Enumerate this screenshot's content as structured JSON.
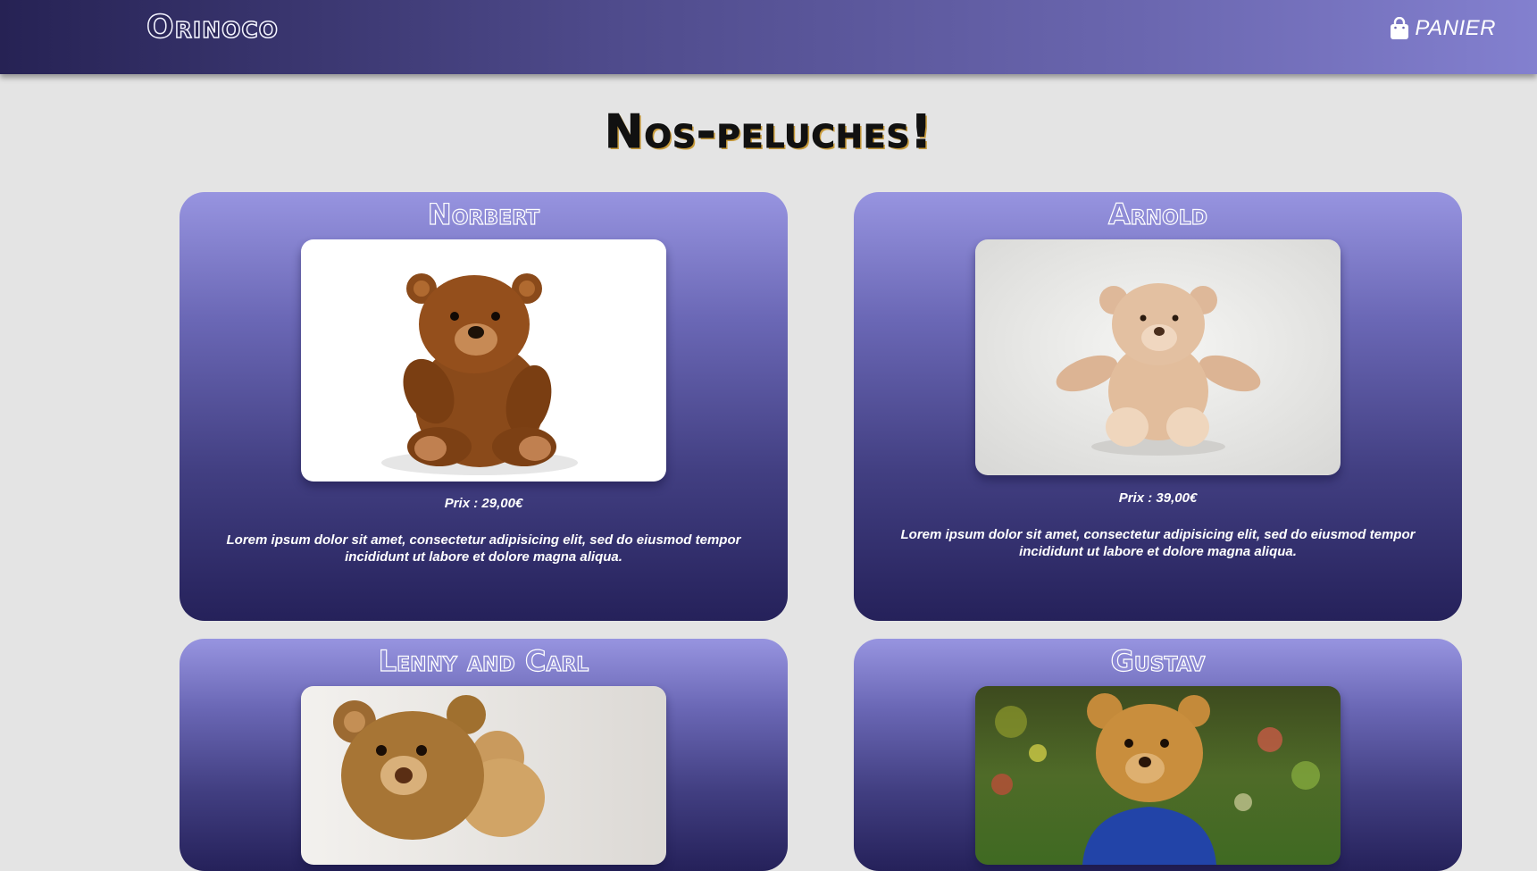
{
  "header": {
    "logo": "Orinoco",
    "cart_label": "PANIER",
    "cart_icon": "shopping-bag-icon"
  },
  "main": {
    "title": "Nos-peluches!"
  },
  "products": [
    {
      "name": "Norbert",
      "price": "Prix : 29,00€",
      "description": "Lorem ipsum dolor sit amet, consectetur adipisicing elit, sed do eiusmod tempor incididunt ut labore et dolore magna aliqua."
    },
    {
      "name": "Arnold",
      "price": "Prix : 39,00€",
      "description": "Lorem ipsum dolor sit amet, consectetur adipisicing elit, sed do eiusmod tempor incididunt ut labore et dolore magna aliqua."
    },
    {
      "name": "Lenny and Carl"
    },
    {
      "name": "Gustav"
    }
  ],
  "colors": {
    "header_start": "#262254",
    "header_end": "#8380cf",
    "card_top": "#9794e0",
    "card_bottom": "#25215a",
    "page_bg": "#e4e4e4"
  }
}
